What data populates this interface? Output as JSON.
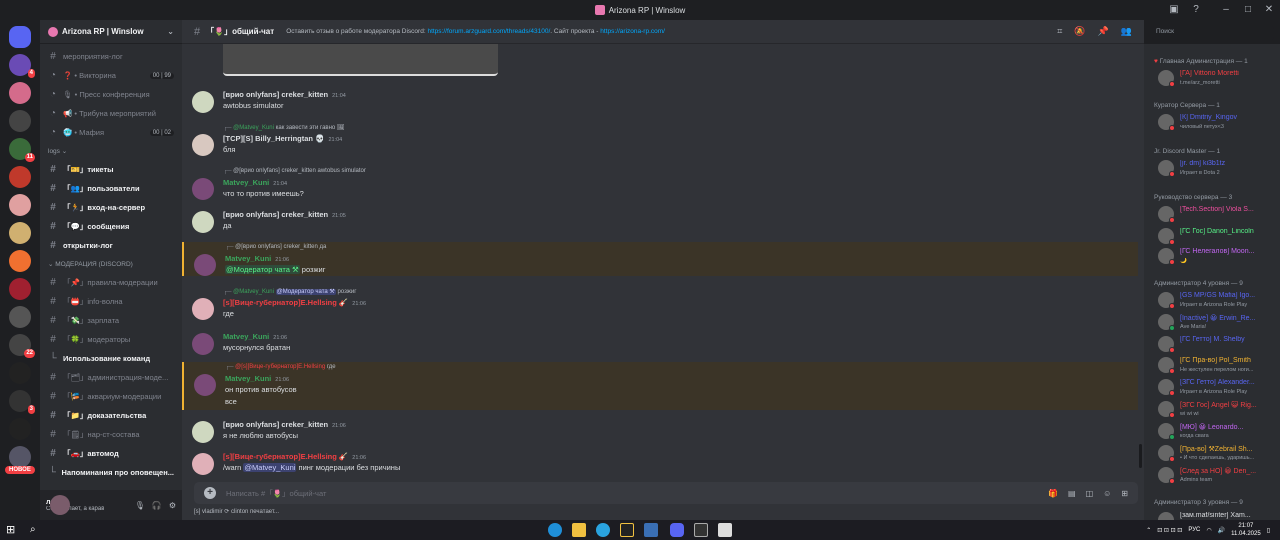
{
  "window": {
    "title": "Arizona RP | Winslow"
  },
  "server": {
    "name": "Arizona RP | Winslow",
    "new_badge": "НОВОЕ"
  },
  "server_badges": [
    "4",
    "11",
    "22",
    "3"
  ],
  "channels": [
    {
      "label": "мероприятия-лог",
      "type": "text",
      "bold": false
    },
    {
      "label": "❓ • Викторина",
      "type": "voice",
      "pill": "00 | 99"
    },
    {
      "label": "🎙 • Пресс конференция",
      "type": "voice"
    },
    {
      "label": "📢 • Трибуна мероприятий",
      "type": "voice"
    },
    {
      "label": "🥶 • Мафия",
      "type": "voice",
      "pill": "00 | 02"
    }
  ],
  "cat_logs": "logs",
  "log_channels": [
    {
      "label": "「🎫」тикеты",
      "bold": true
    },
    {
      "label": "「👥」пользователи",
      "bold": true
    },
    {
      "label": "「🏃」вход-на-сервер",
      "bold": true
    },
    {
      "label": "「💬」сообщения",
      "bold": true
    },
    {
      "label": "открытки-лог",
      "bold": true
    }
  ],
  "cat_mod": "МОДЕРАЦИЯ (DISCORD)",
  "mod_channels": [
    {
      "label": "「📌」правила-модерации",
      "bold": false
    },
    {
      "label": "「📛」info-волна",
      "bold": false
    },
    {
      "label": "「💸」зарплата",
      "bold": false
    },
    {
      "label": "「🍀」модераторы",
      "bold": false
    },
    {
      "label": "Использование команд",
      "bold": true
    },
    {
      "label": "「🗂」администрация-моде...",
      "bold": false
    },
    {
      "label": "「🎏」аквариум-модерации",
      "bold": false
    },
    {
      "label": "「📁」доказательства",
      "bold": true
    },
    {
      "label": "「🗒」нар-ст-состава",
      "bold": false
    },
    {
      "label": "「🚗」автомод",
      "bold": true
    },
    {
      "label": "Напоминания про оповещен...",
      "bold": true
    }
  ],
  "user": {
    "name": "леты",
    "status": "Собака лает, а караван и..."
  },
  "chat": {
    "channel": "「🌷」общий-чат",
    "topic_prefix": "Оставить отзыв о работе модератора Discord:",
    "topic_link1": "https://forum.arzguard.com/threads/43100/",
    "topic_mid": ". Сайт проекта -",
    "topic_link2": "https://arizona-rp.com/",
    "search_placeholder": "Поиск"
  },
  "messages": [
    {
      "user": "[врио onlyfans] creker_kitten",
      "time": "21:04",
      "text": "awtobus simulator",
      "color": "#dbdee1"
    },
    {
      "reply_user": "@Matvey_Kuni",
      "reply_text": "как завести эти гавно 🖼",
      "user": "[TCP][S] Billy_Herringtan 💀",
      "time": "21:04",
      "text": "бля",
      "color": "#dbdee1"
    },
    {
      "reply_user": "@[врио onlyfans] creker_kitten",
      "reply_text": "awtobus simulator",
      "user": "Matvey_Kuni",
      "time": "21:04",
      "text": "что то против имеешь?",
      "color": "#3ba55c"
    },
    {
      "user": "[врио onlyfans] creker_kitten",
      "time": "21:05",
      "text": "да",
      "color": "#dbdee1"
    },
    {
      "reply_user": "@[врио onlyfans] creker_kitten",
      "reply_text": "да",
      "user": "Matvey_Kuni",
      "time": "21:06",
      "mention": "@Модератор чата ⚒",
      "text": "розжиг",
      "color": "#3ba55c"
    },
    {
      "reply_user": "@Matvey_Kuni",
      "reply_mention": "@Модератор чата ⚒",
      "reply_text": "розжиг",
      "user": "[s][Вице-губернатор]E.Hellsing 🎸",
      "time": "21:06",
      "text": "где",
      "color": "#f23f43"
    },
    {
      "user": "Matvey_Kuni",
      "time": "21:06",
      "text": "мусорнулся братан",
      "color": "#3ba55c"
    },
    {
      "reply_user": "@[s][Вице-губернатор]E.Hellsing",
      "reply_text": "где",
      "user": "Matvey_Kuni",
      "time": "21:06",
      "text": "он против автобусов",
      "text2": "все",
      "color": "#3ba55c"
    },
    {
      "user": "[врио onlyfans] creker_kitten",
      "time": "21:06",
      "text": "я не люблю автобусы",
      "color": "#dbdee1"
    },
    {
      "user": "[s][Вице-губернатор]E.Hellsing 🎸",
      "time": "21:06",
      "text_pre": "/warn",
      "mention": "@Matvey_Kuni",
      "text": "пинг модерации без причины",
      "color": "#f23f43"
    }
  ],
  "composer": {
    "placeholder": "Написать #「🌷」общий-чат",
    "typing": "[s] vladimir ⟳ clinton печатает..."
  },
  "members": {
    "groups": [
      {
        "title": "Главная Администрация — 1",
        "members": [
          {
            "name": "[ГА] Vittorio Moretti",
            "status": "t.me/arz_moretti",
            "color": "#f23f43"
          }
        ]
      },
      {
        "title": "Куратор Сервера — 1",
        "members": [
          {
            "name": "[К] Dmitriy_Kingov",
            "status": "чиловый петух<3",
            "color": "#5865f2"
          }
        ]
      },
      {
        "title": "Jr. Discord Master — 1",
        "members": [
          {
            "name": "[jr. dm] ki3b1tz",
            "status": "Играет в Dota 2",
            "color": "#b9bbbe"
          }
        ]
      },
      {
        "title": "Руководство сервера — 3",
        "members": [
          {
            "name": "[Tech.Section] Viola S...",
            "status": "",
            "color": "#ed4f9e"
          },
          {
            "name": "[ГС Гос] Danon_Lincoln",
            "status": "",
            "color": "#57f287"
          },
          {
            "name": "[ГС Нелегалов] Moon...",
            "status": "🌙",
            "color": "#c266f2"
          }
        ]
      },
      {
        "title": "Администратор 4 уровня — 9",
        "members": [
          {
            "name": "[GS MP/GS Mafia] Igo...",
            "status": "Играет в Arizona Role Play",
            "color": "#5865f2"
          },
          {
            "name": "[Inactive] 😀 Erwin_Re...",
            "status": "Ave Maria!",
            "color": "#5865f2"
          },
          {
            "name": "[ГС Гетто] M. Shelby",
            "status": "",
            "color": "#5865f2"
          },
          {
            "name": "[ГС Пра-во] Pol_Smith",
            "status": "Не жестулен перелом ноги...",
            "color": "#f0b232"
          },
          {
            "name": "[ЗГС Гетто] Alexander...",
            "status": "Играет в Arizona Role Play",
            "color": "#5865f2"
          },
          {
            "name": "[ЗГС Гос] Angel 😺 Rig...",
            "status": "wi wi wi",
            "color": "#f23f43"
          },
          {
            "name": "[МЮ] 😀 Leonardo...",
            "status": "когда свага",
            "color": "#c266f2"
          },
          {
            "name": "[Пра-во] ⚒Zebrail Sh...",
            "status": "• И что сделаешь, ударишь...",
            "color": "#f0b232"
          },
          {
            "name": "[След за НО] 😀 Den_...",
            "status": "Admins team",
            "color": "#f23f43"
          }
        ]
      },
      {
        "title": "Администратор 3 уровня — 9",
        "members": [
          {
            "name": "[зам.maf/sinter] Xam...",
            "status": "",
            "color": "#dbdee1"
          }
        ]
      }
    ]
  },
  "taskbar": {
    "time": "21:07",
    "date": "11.04.2025",
    "lang": "РУС"
  },
  "colors": {
    "bg_chat": "#313338",
    "bg_side": "#2b2d31",
    "accent": "#5865f2"
  }
}
